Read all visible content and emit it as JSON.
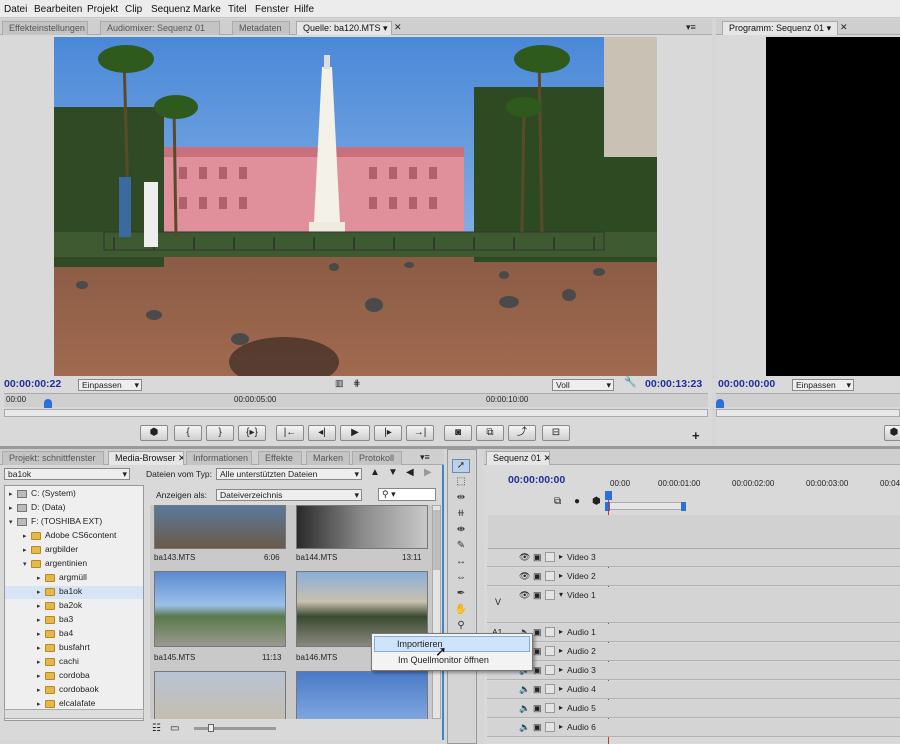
{
  "menu": [
    "Datei",
    "Bearbeiten",
    "Projekt",
    "Clip",
    "Sequenz",
    "Marke",
    "Titel",
    "Fenster",
    "Hilfe"
  ],
  "top_tabs": [
    "Effekteinstellungen",
    "Audiomixer: Sequenz 01",
    "Metadaten",
    "Quelle: ba120.MTS",
    "Programm: Sequenz 01"
  ],
  "source": {
    "timecode_in": "00:00:00:22",
    "fit": "Einpassen",
    "quality": "Voll",
    "timecode_out": "00:00:13:23",
    "ruler": [
      "00:00",
      "00:00:05:00",
      "00:00:10:00"
    ]
  },
  "program": {
    "timecode": "00:00:00:00",
    "fit": "Einpassen"
  },
  "bottom_tabs": [
    "Projekt: schnittfenster",
    "Media-Browser",
    "Informationen",
    "Effekte",
    "Marken",
    "Protokoll"
  ],
  "browser": {
    "folder_select": "ba1ok",
    "file_type_label": "Dateien vom Typ:",
    "file_type": "Alle unterstützten Dateien",
    "view_label": "Anzeigen als:",
    "view": "Dateiverzeichnis"
  },
  "tree": [
    {
      "label": "C: (System)",
      "type": "drive",
      "indent": 0,
      "open": false
    },
    {
      "label": "D: (Data)",
      "type": "drive",
      "indent": 0,
      "open": false
    },
    {
      "label": "F: (TOSHIBA EXT)",
      "type": "drive",
      "indent": 0,
      "open": true
    },
    {
      "label": "Adobe CS6content",
      "type": "folder",
      "indent": 1,
      "open": false
    },
    {
      "label": "argbilder",
      "type": "folder",
      "indent": 1,
      "open": false
    },
    {
      "label": "argentinien",
      "type": "folder",
      "indent": 1,
      "open": true
    },
    {
      "label": "argmüll",
      "type": "folder",
      "indent": 2,
      "open": false
    },
    {
      "label": "ba1ok",
      "type": "folder",
      "indent": 2,
      "open": false,
      "selected": true
    },
    {
      "label": "ba2ok",
      "type": "folder",
      "indent": 2,
      "open": false
    },
    {
      "label": "ba3",
      "type": "folder",
      "indent": 2,
      "open": false
    },
    {
      "label": "ba4",
      "type": "folder",
      "indent": 2,
      "open": false
    },
    {
      "label": "busfahrt",
      "type": "folder",
      "indent": 2,
      "open": false
    },
    {
      "label": "cachi",
      "type": "folder",
      "indent": 2,
      "open": false
    },
    {
      "label": "cordoba",
      "type": "folder",
      "indent": 2,
      "open": false
    },
    {
      "label": "cordobaok",
      "type": "folder",
      "indent": 2,
      "open": false
    },
    {
      "label": "elcalafate",
      "type": "folder",
      "indent": 2,
      "open": false
    }
  ],
  "thumbs": [
    {
      "name": "ba143.MTS",
      "duration": "6:06"
    },
    {
      "name": "ba144.MTS",
      "duration": "13:11"
    },
    {
      "name": "ba145.MTS",
      "duration": "11:13"
    },
    {
      "name": "ba146.MTS",
      "duration": ""
    }
  ],
  "context_menu": [
    "Importieren",
    "Im Quellmonitor öffnen"
  ],
  "sequence": {
    "tab": "Sequenz 01",
    "timecode": "00:00:00:00",
    "ruler": [
      "00:00",
      "00:00:01:00",
      "00:00:02:00",
      "00:00:03:00",
      "00:04"
    ],
    "tracks": [
      {
        "label": "Video 3",
        "kind": "v"
      },
      {
        "label": "Video 2",
        "kind": "v"
      },
      {
        "label": "Video 1",
        "kind": "v",
        "tall": true
      },
      {
        "label": "Audio 1",
        "kind": "a"
      },
      {
        "label": "Audio 2",
        "kind": "a"
      },
      {
        "label": "Audio 3",
        "kind": "a"
      },
      {
        "label": "Audio 4",
        "kind": "a"
      },
      {
        "label": "Audio 5",
        "kind": "a"
      },
      {
        "label": "Audio 6",
        "kind": "a"
      }
    ],
    "v_label": "V",
    "a_label": "A1"
  }
}
